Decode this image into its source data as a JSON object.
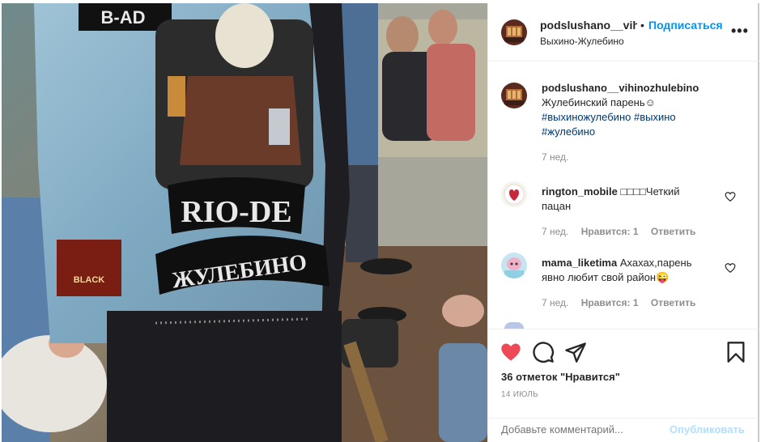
{
  "header": {
    "username": "podslushano__vihinozhulebino",
    "dot": "•",
    "follow_label": "Подписаться",
    "location": "Выхино-Жулебино",
    "more_label": "•••"
  },
  "photo": {
    "patch_top": "B-AD",
    "patch_rio": "RIO-DE",
    "patch_city": "ЖУЛЕБИНО",
    "patch_small": "BLACK"
  },
  "caption": {
    "username": "podslushano__vihinozhulebino",
    "text": "Жулебинский парень☺",
    "tags": [
      "#выхиножулебино",
      "#выхино",
      "#жулебино"
    ],
    "time": "7 нед."
  },
  "comments": [
    {
      "username": "rington_mobile",
      "text": " □□□□Четкий пацан",
      "time": "7 нед.",
      "likes": "Нравится: 1",
      "reply": "Ответить"
    },
    {
      "username": "mama_liketima",
      "text": " Ахахах,парень явно любит свой район😜",
      "time": "7 нед.",
      "likes": "Нравится: 1",
      "reply": "Ответить"
    }
  ],
  "actions": {
    "likes_text": "36 отметок \"Нравится\"",
    "date": "14 ИЮЛЬ"
  },
  "add_comment": {
    "placeholder": "Добавьте комментарий...",
    "publish_label": "Опубликовать"
  },
  "colors": {
    "link_blue": "#0095f6",
    "like_red": "#ed4956",
    "muted": "#8e8e8e",
    "publish_disabled": "#b2dffc"
  },
  "icons": [
    "heart-icon",
    "comment-icon",
    "share-icon",
    "bookmark-icon",
    "more-icon",
    "small-heart-icon"
  ]
}
